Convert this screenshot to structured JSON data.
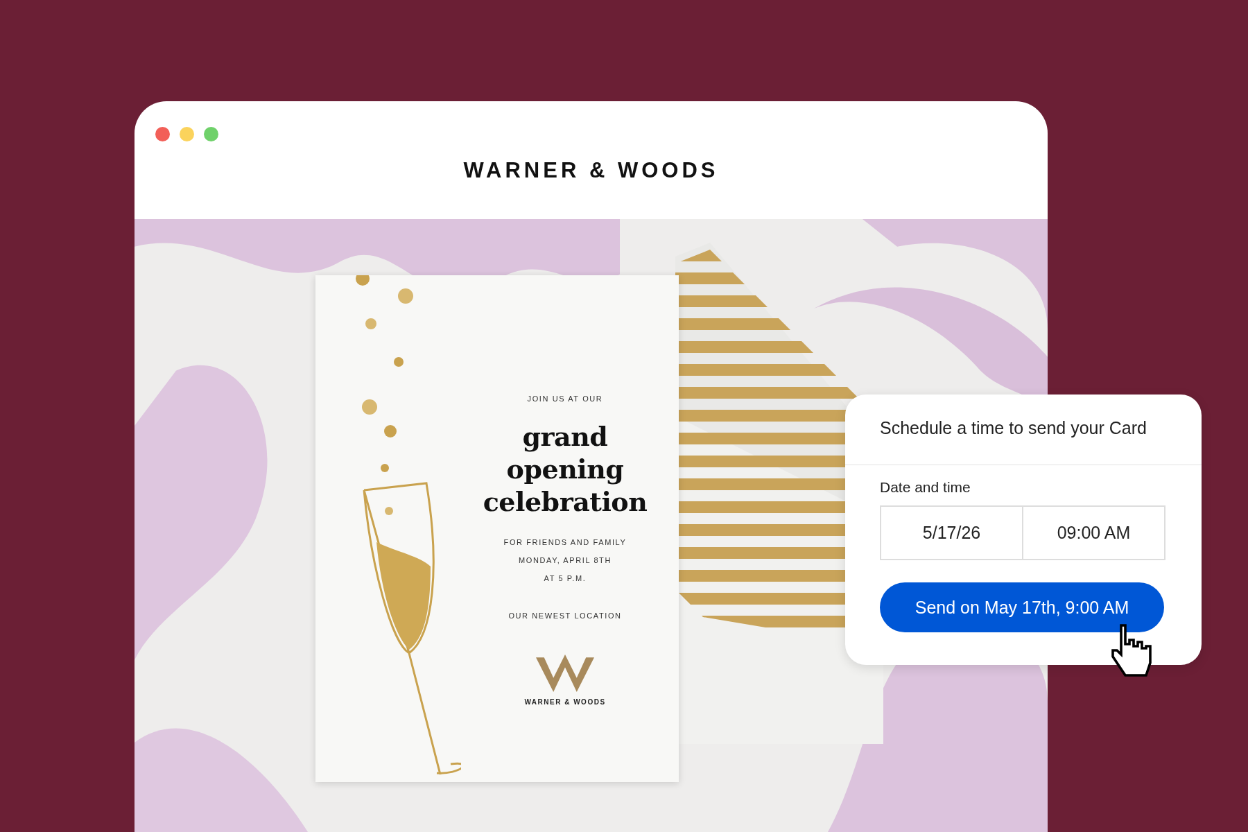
{
  "window": {
    "controls": [
      {
        "color": "#f25f58"
      },
      {
        "color": "#fbd35c"
      },
      {
        "color": "#6fd16a"
      }
    ],
    "title": "WARNER & WOODS"
  },
  "card": {
    "intro": "JOIN US AT OUR",
    "headline": [
      "grand",
      "opening",
      "celebration"
    ],
    "details": [
      "FOR FRIENDS AND FAMILY",
      "MONDAY, APRIL 8TH",
      "AT 5 P.M."
    ],
    "location": "OUR NEWEST LOCATION",
    "logo_text": "WARNER & WOODS"
  },
  "schedule": {
    "title": "Schedule a time to send your Card",
    "label": "Date and time",
    "date": "5/17/26",
    "time": "09:00 AM",
    "button": "Send on May 17th, 9:00 AM"
  }
}
